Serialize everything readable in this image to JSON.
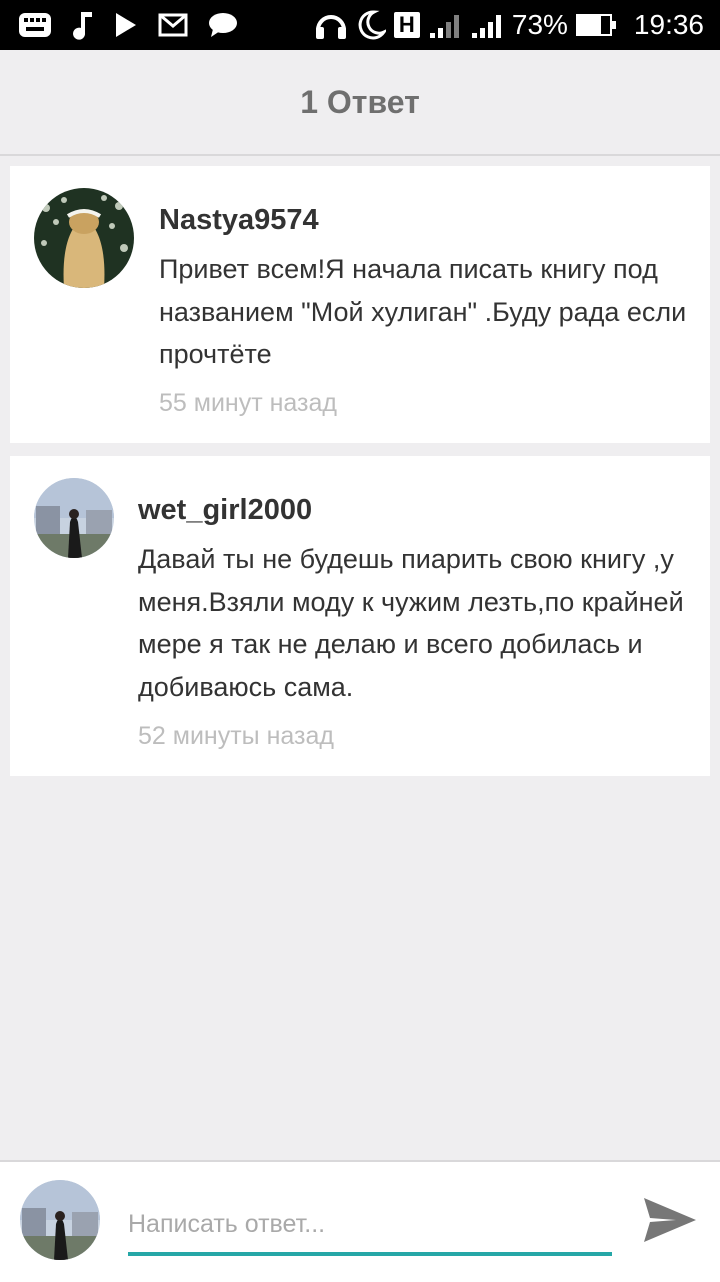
{
  "status_bar": {
    "battery_percent": "73%",
    "battery_level": 0.73,
    "network_label": "H",
    "time": "19:36",
    "icons": [
      "keyboard-icon",
      "music-note-icon",
      "play-icon",
      "mail-icon",
      "chat-icon",
      "headphones-icon",
      "moon-icon",
      "h-network-icon",
      "signal-icon",
      "signal-icon",
      "battery-icon"
    ]
  },
  "header": {
    "title": "1 Ответ"
  },
  "comments": [
    {
      "username": "Nastya9574",
      "message": "Привет всем!Я начала писать книгу под названием \"Мой хулиган\" .Буду рада если прочтёте",
      "time": "55 минут назад"
    },
    {
      "username": "wet_girl2000",
      "message": "Давай ты не будешь пиарить свою книгу ,у меня.Взяли моду к чужим лезть,по крайней мере я так не делаю и всего добилась и добиваюсь сама.",
      "time": "52 минуты назад"
    }
  ],
  "reply": {
    "placeholder": "Написать ответ...",
    "value": ""
  },
  "colors": {
    "accent": "#26a7a7",
    "background": "#efeef0",
    "card": "#ffffff"
  }
}
